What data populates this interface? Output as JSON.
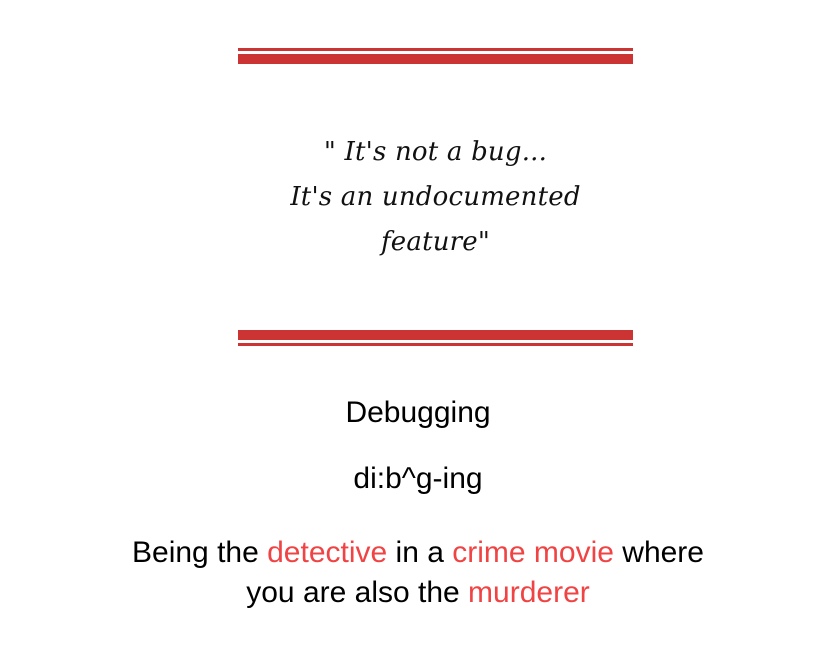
{
  "colors": {
    "accent": "#cc3333",
    "highlight": "#f04444"
  },
  "quote": {
    "line1": "\" It's not a bug...",
    "line2": "It's an undocumented",
    "line3": "feature\""
  },
  "term": {
    "word": "Debugging",
    "pronunciation": "di:b^g-ing"
  },
  "definition": {
    "t1": "Being the ",
    "h1": "detective",
    "t2": " in a ",
    "h2": "crime movie",
    "t3": " where",
    "t4": "you are also the ",
    "h3": "murderer"
  }
}
